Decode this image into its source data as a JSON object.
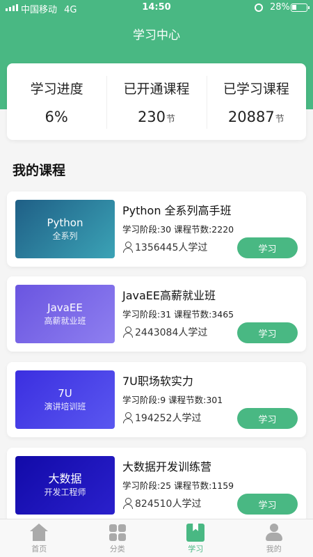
{
  "status_bar": {
    "carrier": "中国移动",
    "network": "4G",
    "time": "14:50",
    "battery": "28%"
  },
  "header": {
    "title": "学习中心"
  },
  "stats": [
    {
      "label": "学习进度",
      "value": "6%",
      "unit": ""
    },
    {
      "label": "已开通课程",
      "value": "230",
      "unit": "节"
    },
    {
      "label": "已学习课程",
      "value": "20887",
      "unit": "节"
    }
  ],
  "section_title": "我的课程",
  "courses": [
    {
      "thumb_line1": "Python",
      "thumb_line2": "全系列",
      "title": "Python 全系列高手班",
      "meta": "学习阶段:30 课程节数:2220",
      "learners": "1356445人学过",
      "button": "学习",
      "thumb_color": "#2f8fa3"
    },
    {
      "thumb_line1": "JavaEE",
      "thumb_line2": "高薪就业班",
      "title": "JavaEE高薪就业班",
      "meta": "学习阶段:31 课程节数:3465",
      "learners": "2443084人学过",
      "button": "学习",
      "thumb_color": "#7a62e6"
    },
    {
      "thumb_line1": "7U",
      "thumb_line2": "演讲培训班",
      "title": "7U职场软实力",
      "meta": "学习阶段:9 课程节数:301",
      "learners": "194252人学过",
      "button": "学习",
      "thumb_color": "#4a3fe8"
    },
    {
      "thumb_line1": "大数据",
      "thumb_line2": "开发工程师",
      "title": "大数据开发训练营",
      "meta": "学习阶段:25 课程节数:1159",
      "learners": "824510人学过",
      "button": "学习",
      "thumb_color": "#1a12b8"
    }
  ],
  "tabs": [
    {
      "label": "首页",
      "icon": "home-icon"
    },
    {
      "label": "分类",
      "icon": "category-grid-icon"
    },
    {
      "label": "学习",
      "icon": "bookmark-icon"
    },
    {
      "label": "我的",
      "icon": "profile-icon"
    }
  ],
  "colors": {
    "accent": "#49b883"
  }
}
